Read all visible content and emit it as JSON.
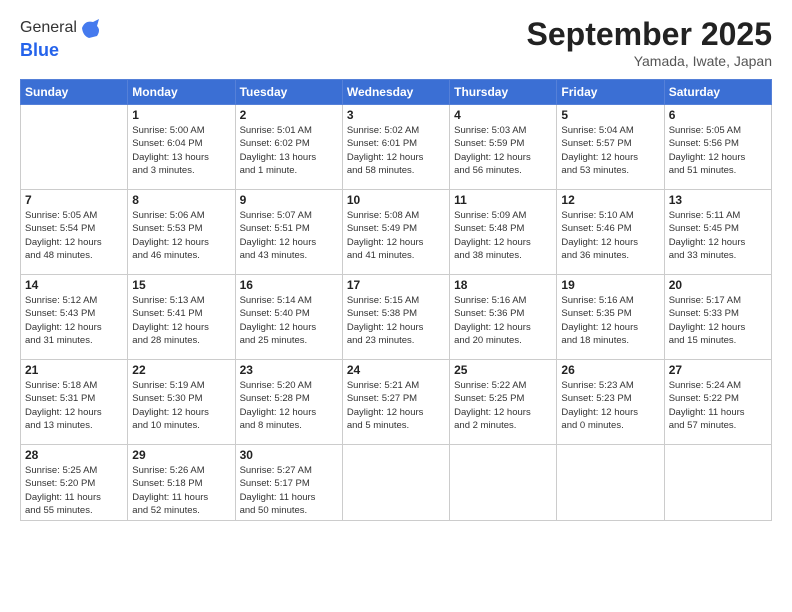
{
  "header": {
    "logo_line1": "General",
    "logo_line2": "Blue",
    "month": "September 2025",
    "location": "Yamada, Iwate, Japan"
  },
  "weekdays": [
    "Sunday",
    "Monday",
    "Tuesday",
    "Wednesday",
    "Thursday",
    "Friday",
    "Saturday"
  ],
  "weeks": [
    [
      {
        "day": "",
        "info": ""
      },
      {
        "day": "1",
        "info": "Sunrise: 5:00 AM\nSunset: 6:04 PM\nDaylight: 13 hours\nand 3 minutes."
      },
      {
        "day": "2",
        "info": "Sunrise: 5:01 AM\nSunset: 6:02 PM\nDaylight: 13 hours\nand 1 minute."
      },
      {
        "day": "3",
        "info": "Sunrise: 5:02 AM\nSunset: 6:01 PM\nDaylight: 12 hours\nand 58 minutes."
      },
      {
        "day": "4",
        "info": "Sunrise: 5:03 AM\nSunset: 5:59 PM\nDaylight: 12 hours\nand 56 minutes."
      },
      {
        "day": "5",
        "info": "Sunrise: 5:04 AM\nSunset: 5:57 PM\nDaylight: 12 hours\nand 53 minutes."
      },
      {
        "day": "6",
        "info": "Sunrise: 5:05 AM\nSunset: 5:56 PM\nDaylight: 12 hours\nand 51 minutes."
      }
    ],
    [
      {
        "day": "7",
        "info": "Sunrise: 5:05 AM\nSunset: 5:54 PM\nDaylight: 12 hours\nand 48 minutes."
      },
      {
        "day": "8",
        "info": "Sunrise: 5:06 AM\nSunset: 5:53 PM\nDaylight: 12 hours\nand 46 minutes."
      },
      {
        "day": "9",
        "info": "Sunrise: 5:07 AM\nSunset: 5:51 PM\nDaylight: 12 hours\nand 43 minutes."
      },
      {
        "day": "10",
        "info": "Sunrise: 5:08 AM\nSunset: 5:49 PM\nDaylight: 12 hours\nand 41 minutes."
      },
      {
        "day": "11",
        "info": "Sunrise: 5:09 AM\nSunset: 5:48 PM\nDaylight: 12 hours\nand 38 minutes."
      },
      {
        "day": "12",
        "info": "Sunrise: 5:10 AM\nSunset: 5:46 PM\nDaylight: 12 hours\nand 36 minutes."
      },
      {
        "day": "13",
        "info": "Sunrise: 5:11 AM\nSunset: 5:45 PM\nDaylight: 12 hours\nand 33 minutes."
      }
    ],
    [
      {
        "day": "14",
        "info": "Sunrise: 5:12 AM\nSunset: 5:43 PM\nDaylight: 12 hours\nand 31 minutes."
      },
      {
        "day": "15",
        "info": "Sunrise: 5:13 AM\nSunset: 5:41 PM\nDaylight: 12 hours\nand 28 minutes."
      },
      {
        "day": "16",
        "info": "Sunrise: 5:14 AM\nSunset: 5:40 PM\nDaylight: 12 hours\nand 25 minutes."
      },
      {
        "day": "17",
        "info": "Sunrise: 5:15 AM\nSunset: 5:38 PM\nDaylight: 12 hours\nand 23 minutes."
      },
      {
        "day": "18",
        "info": "Sunrise: 5:16 AM\nSunset: 5:36 PM\nDaylight: 12 hours\nand 20 minutes."
      },
      {
        "day": "19",
        "info": "Sunrise: 5:16 AM\nSunset: 5:35 PM\nDaylight: 12 hours\nand 18 minutes."
      },
      {
        "day": "20",
        "info": "Sunrise: 5:17 AM\nSunset: 5:33 PM\nDaylight: 12 hours\nand 15 minutes."
      }
    ],
    [
      {
        "day": "21",
        "info": "Sunrise: 5:18 AM\nSunset: 5:31 PM\nDaylight: 12 hours\nand 13 minutes."
      },
      {
        "day": "22",
        "info": "Sunrise: 5:19 AM\nSunset: 5:30 PM\nDaylight: 12 hours\nand 10 minutes."
      },
      {
        "day": "23",
        "info": "Sunrise: 5:20 AM\nSunset: 5:28 PM\nDaylight: 12 hours\nand 8 minutes."
      },
      {
        "day": "24",
        "info": "Sunrise: 5:21 AM\nSunset: 5:27 PM\nDaylight: 12 hours\nand 5 minutes."
      },
      {
        "day": "25",
        "info": "Sunrise: 5:22 AM\nSunset: 5:25 PM\nDaylight: 12 hours\nand 2 minutes."
      },
      {
        "day": "26",
        "info": "Sunrise: 5:23 AM\nSunset: 5:23 PM\nDaylight: 12 hours\nand 0 minutes."
      },
      {
        "day": "27",
        "info": "Sunrise: 5:24 AM\nSunset: 5:22 PM\nDaylight: 11 hours\nand 57 minutes."
      }
    ],
    [
      {
        "day": "28",
        "info": "Sunrise: 5:25 AM\nSunset: 5:20 PM\nDaylight: 11 hours\nand 55 minutes."
      },
      {
        "day": "29",
        "info": "Sunrise: 5:26 AM\nSunset: 5:18 PM\nDaylight: 11 hours\nand 52 minutes."
      },
      {
        "day": "30",
        "info": "Sunrise: 5:27 AM\nSunset: 5:17 PM\nDaylight: 11 hours\nand 50 minutes."
      },
      {
        "day": "",
        "info": ""
      },
      {
        "day": "",
        "info": ""
      },
      {
        "day": "",
        "info": ""
      },
      {
        "day": "",
        "info": ""
      }
    ]
  ]
}
